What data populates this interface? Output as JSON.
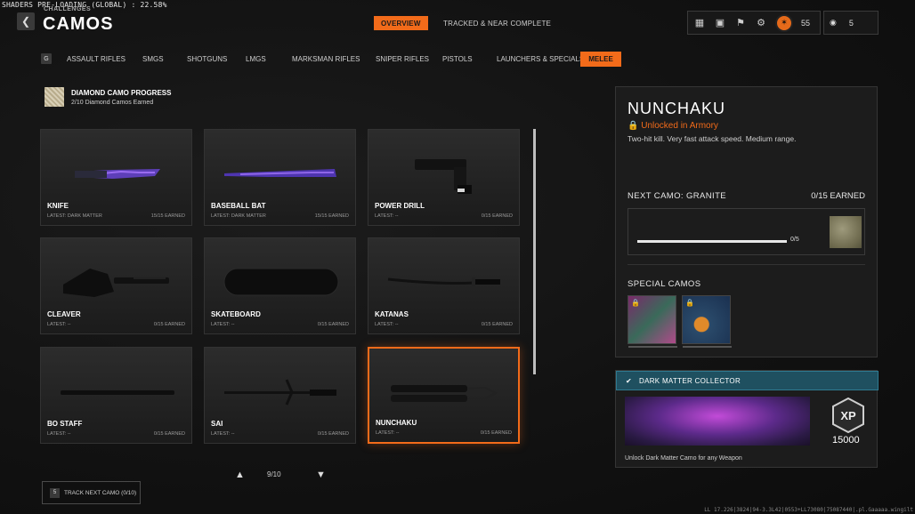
{
  "debug": {
    "shader_text": "SHADERS PRE-LOADING (GLOBAL) : 22.58%"
  },
  "header": {
    "breadcrumb": "CHALLENGES",
    "title": "CAMOS",
    "back_icon": "chevron-left-icon"
  },
  "top_tabs": [
    {
      "label": "OVERVIEW",
      "active": true
    },
    {
      "label": "TRACKED & NEAR COMPLETE",
      "active": false
    }
  ],
  "status": {
    "level": "55",
    "party_count": "5"
  },
  "categories": {
    "key_hint": "G",
    "items": [
      {
        "label": "ASSAULT RIFLES",
        "active": false
      },
      {
        "label": "SMGS",
        "active": false
      },
      {
        "label": "SHOTGUNS",
        "active": false
      },
      {
        "label": "LMGS",
        "active": false
      },
      {
        "label": "MARKSMAN RIFLES",
        "active": false
      },
      {
        "label": "SNIPER RIFLES",
        "active": false
      },
      {
        "label": "PISTOLS",
        "active": false
      },
      {
        "label": "LAUNCHERS & SPECIALS",
        "active": false
      },
      {
        "label": "MELEE",
        "active": true
      }
    ]
  },
  "diamond_progress": {
    "title": "DIAMOND CAMO PROGRESS",
    "subtitle": "2/10 Diamond Camos Earned"
  },
  "weapons": [
    {
      "name": "KNIFE",
      "latest": "LATEST: DARK MATTER",
      "earned": "15/15 EARNED",
      "selected": false
    },
    {
      "name": "BASEBALL BAT",
      "latest": "LATEST: DARK MATTER",
      "earned": "15/15 EARNED",
      "selected": false
    },
    {
      "name": "POWER DRILL",
      "latest": "LATEST: --",
      "earned": "0/15 EARNED",
      "selected": false
    },
    {
      "name": "CLEAVER",
      "latest": "LATEST: --",
      "earned": "0/15 EARNED",
      "selected": false
    },
    {
      "name": "SKATEBOARD",
      "latest": "LATEST: --",
      "earned": "0/15 EARNED",
      "selected": false
    },
    {
      "name": "KATANAS",
      "latest": "LATEST: --",
      "earned": "0/15 EARNED",
      "selected": false
    },
    {
      "name": "BO STAFF",
      "latest": "LATEST: --",
      "earned": "0/15 EARNED",
      "selected": false
    },
    {
      "name": "SAI",
      "latest": "LATEST: --",
      "earned": "0/15 EARNED",
      "selected": false
    },
    {
      "name": "NUNCHAKU",
      "latest": "LATEST: --",
      "earned": "0/15 EARNED",
      "selected": true
    }
  ],
  "pagination": {
    "label": "9/10"
  },
  "track_button": {
    "key": "5",
    "label": "TRACK NEXT CAMO (0/10)"
  },
  "detail": {
    "title": "NUNCHAKU",
    "unlock": "Unlocked in Armory",
    "description": "Two-hit kill.  Very fast attack speed. Medium range.",
    "next_camo_label": "NEXT CAMO: GRANITE",
    "next_camo_earned": "0/15 EARNED",
    "next_camo_count": "0/5",
    "next_camo_fraction": 0,
    "special_label": "SPECIAL CAMOS"
  },
  "reward": {
    "title": "DARK MATTER COLLECTOR",
    "xp_label": "XP",
    "xp_value": "15000",
    "description": "Unlock Dark Matter Camo for any Weapon"
  },
  "footer": {
    "build": "LL 17.226|3824|94-3.3L42|0553+LL73080|75087440|.pl.Gaaaaa.wingilt"
  },
  "colors": {
    "accent": "#f26b1a",
    "reward_header": "#1f5060",
    "dark_matter": "#7a3ad8"
  }
}
